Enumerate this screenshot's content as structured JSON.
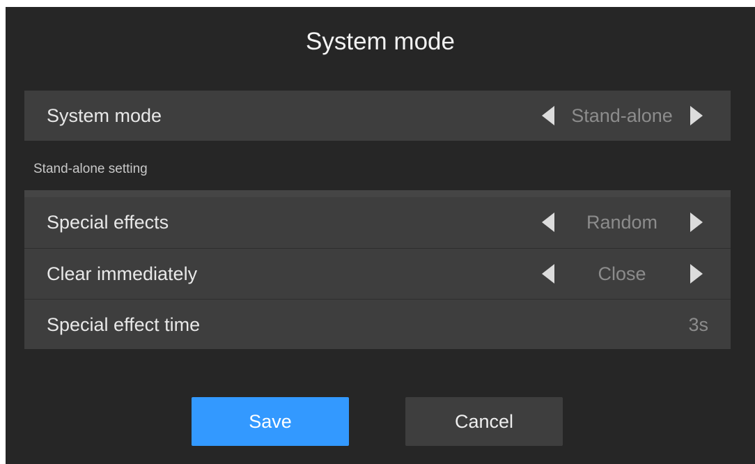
{
  "dialog": {
    "title": "System mode"
  },
  "system_mode_row": {
    "label": "System mode",
    "value": "Stand-alone"
  },
  "standalone_section": {
    "caption": "Stand-alone setting",
    "rows": [
      {
        "label": "Special effects",
        "value": "Random"
      },
      {
        "label": "Clear immediately",
        "value": "Close"
      },
      {
        "label": "Special effect time",
        "value": "3s"
      }
    ]
  },
  "buttons": {
    "save_label": "Save",
    "cancel_label": "Cancel"
  },
  "colors": {
    "background": "#262626",
    "row_background": "#3e3e3e",
    "accent": "#3399ff",
    "value_text": "#8c8c8c"
  },
  "icons": [
    "arrow-left-icon",
    "arrow-right-icon"
  ]
}
